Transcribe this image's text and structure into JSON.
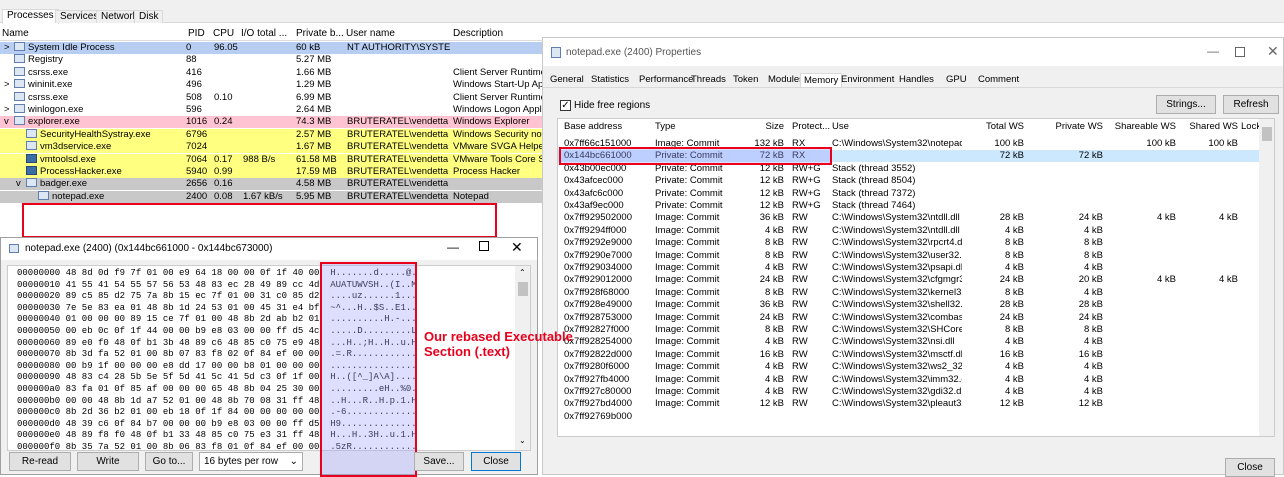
{
  "tabs": [
    "Processes",
    "Services",
    "Network",
    "Disk"
  ],
  "process_columns": [
    "Name",
    "PID",
    "CPU",
    "I/O total ...",
    "Private b...",
    "User name",
    "Description"
  ],
  "processes": [
    {
      "name": "System Idle Process",
      "pid": "0",
      "cpu": "96.05",
      "io": "",
      "priv": "60 kB",
      "user": "NT AUTHORITY\\SYSTEM",
      "desc": "",
      "indent": 0,
      "expander": ">",
      "bg": "#b7cdf2"
    },
    {
      "name": "Registry",
      "pid": "88",
      "cpu": "",
      "io": "",
      "priv": "5.27 MB",
      "user": "",
      "desc": "",
      "indent": 0,
      "expander": "",
      "bg": "#ffffff"
    },
    {
      "name": "csrss.exe",
      "pid": "416",
      "cpu": "",
      "io": "",
      "priv": "1.66 MB",
      "user": "",
      "desc": "Client Server Runtime",
      "indent": 0,
      "expander": "",
      "bg": "#ffffff"
    },
    {
      "name": "wininit.exe",
      "pid": "496",
      "cpu": "",
      "io": "",
      "priv": "1.29 MB",
      "user": "",
      "desc": "Windows Start-Up Ap",
      "indent": 0,
      "expander": ">",
      "bg": "#ffffff"
    },
    {
      "name": "csrss.exe",
      "pid": "508",
      "cpu": "0.10",
      "io": "",
      "priv": "6.99 MB",
      "user": "",
      "desc": "Client Server Runtime",
      "indent": 0,
      "expander": "",
      "bg": "#ffffff"
    },
    {
      "name": "winlogon.exe",
      "pid": "596",
      "cpu": "",
      "io": "",
      "priv": "2.64 MB",
      "user": "",
      "desc": "Windows Logon Appl",
      "indent": 0,
      "expander": ">",
      "bg": "#ffffff"
    },
    {
      "name": "explorer.exe",
      "pid": "1016",
      "cpu": "0.24",
      "io": "",
      "priv": "74.3 MB",
      "user": "BRUTERATEL\\vendetta",
      "desc": "Windows Explorer",
      "indent": 0,
      "expander": "v",
      "bg": "#ffc3d2"
    },
    {
      "name": "SecurityHealthSystray.exe",
      "pid": "6796",
      "cpu": "",
      "io": "",
      "priv": "2.57 MB",
      "user": "BRUTERATEL\\vendetta",
      "desc": "Windows Security not",
      "indent": 1,
      "expander": "",
      "bg": "#ffff80"
    },
    {
      "name": "vm3dservice.exe",
      "pid": "7024",
      "cpu": "",
      "io": "",
      "priv": "1.67 MB",
      "user": "BRUTERATEL\\vendetta",
      "desc": "VMware SVGA Helper",
      "indent": 1,
      "expander": "",
      "bg": "#ffff80"
    },
    {
      "name": "vmtoolsd.exe",
      "pid": "7064",
      "cpu": "0.17",
      "io": "988 B/s",
      "priv": "61.58 MB",
      "user": "BRUTERATEL\\vendetta",
      "desc": "VMware Tools Core Se",
      "indent": 1,
      "expander": "",
      "bg": "#ffff80"
    },
    {
      "name": "ProcessHacker.exe",
      "pid": "5940",
      "cpu": "0.99",
      "io": "",
      "priv": "17.59 MB",
      "user": "BRUTERATEL\\vendetta",
      "desc": "Process Hacker",
      "indent": 1,
      "expander": "",
      "bg": "#ffff80"
    },
    {
      "name": "badger.exe",
      "pid": "2656",
      "cpu": "0.16",
      "io": "",
      "priv": "4.58 MB",
      "user": "BRUTERATEL\\vendetta",
      "desc": "",
      "indent": 1,
      "expander": "v",
      "bg": "#c8c8c8"
    },
    {
      "name": "notepad.exe",
      "pid": "2400",
      "cpu": "0.08",
      "io": "1.67 kB/s",
      "priv": "5.95 MB",
      "user": "BRUTERATEL\\vendetta",
      "desc": "Notepad",
      "indent": 2,
      "expander": "",
      "bg": "#c8c8c8"
    }
  ],
  "hex_window": {
    "title": "notepad.exe (2400) (0x144bc661000 - 0x144bc673000)",
    "lines": [
      {
        "addr": "00000000",
        "hex": "48 8d 0d f9 7f 01 00 e9 64 18 00 00 0f 1f 40 00",
        "ascii": "H.......d.....@."
      },
      {
        "addr": "00000010",
        "hex": "41 55 41 54 55 57 56 53 48 83 ec 28 49 89 cc 4d",
        "ascii": "AUATUWVSH..(I..M"
      },
      {
        "addr": "00000020",
        "hex": "89 c5 85 d2 75 7a 8b 15 ec 7f 01 00 31 c0 85 d2",
        "ascii": "....uz......1..."
      },
      {
        "addr": "00000030",
        "hex": "7e 5e 83 ea 01 48 8b 1d 24 53 01 00 45 31 e4 bf",
        "ascii": "~^...H..$S..E1.."
      },
      {
        "addr": "00000040",
        "hex": "01 00 00 00 89 15 ce 7f 01 00 48 8b 2d ab b2 01",
        "ascii": "..........H.-..."
      },
      {
        "addr": "00000050",
        "hex": "00 eb 0c 0f 1f 44 00 00 b9 e8 03 00 00 ff d5 4c",
        "ascii": ".....D.........L"
      },
      {
        "addr": "00000060",
        "hex": "89 e0 f0 48 0f b1 3b 48 89 c6 48 85 c0 75 e9 48",
        "ascii": "...H..;H..H..u.H"
      },
      {
        "addr": "00000070",
        "hex": "8b 3d fa 52 01 00 8b 07 83 f8 02 0f 84 ef 00 00",
        "ascii": ".=.R............"
      },
      {
        "addr": "00000080",
        "hex": "00 b9 1f 00 00 00 e8 dd 17 00 00 b8 01 00 00 00",
        "ascii": "................"
      },
      {
        "addr": "00000090",
        "hex": "48 83 c4 28 5b 5e 5f 5d 41 5c 41 5d c3 0f 1f 00",
        "ascii": "H..([^_]A\\A]...."
      },
      {
        "addr": "000000a0",
        "hex": "83 fa 01 0f 85 af 00 00 00 65 48 8b 04 25 30 00",
        "ascii": ".........eH..%0."
      },
      {
        "addr": "000000b0",
        "hex": "00 00 48 8b 1d a7 52 01 00 48 8b 70 08 31 ff 48",
        "ascii": "..H...R..H.p.1.H"
      },
      {
        "addr": "000000c0",
        "hex": "8b 2d 36 b2 01 00 eb 18 0f 1f 84 00 00 00 00 00",
        "ascii": ".-6............."
      },
      {
        "addr": "000000d0",
        "hex": "48 39 c6 0f 84 b7 00 00 00 b9 e8 03 00 00 ff d5",
        "ascii": "H9.............."
      },
      {
        "addr": "000000e0",
        "hex": "48 89 f8 f0 48 0f b1 33 48 85 c0 75 e3 31 ff 48",
        "ascii": "H...H..3H..u.1.H"
      },
      {
        "addr": "000000f0",
        "hex": "8b 35 7a 52 01 00 8b 06 83 f8 01 0f 84 ef 00 00",
        "ascii": ".5zR............"
      }
    ],
    "buttons": {
      "reread": "Re-read",
      "write": "Write",
      "goto": "Go to...",
      "bytes_per_row": "16 bytes per row",
      "save": "Save...",
      "close": "Close"
    }
  },
  "annotation": {
    "line1": "Our rebased Executable",
    "line2": "Section (.text)",
    "color": "#e8001c"
  },
  "properties": {
    "title": "notepad.exe (2400) Properties",
    "tabs": [
      "General",
      "Statistics",
      "Performance",
      "Threads",
      "Token",
      "Modules",
      "Memory",
      "Environment",
      "Handles",
      "GPU",
      "Comment"
    ],
    "active_tab": "Memory",
    "hide_free_label": "Hide free regions",
    "strings_btn": "Strings...",
    "refresh_btn": "Refresh",
    "close_btn": "Close",
    "columns": [
      "Base address",
      "Type",
      "Size",
      "Protect...",
      "Use",
      "Total WS",
      "Private WS",
      "Shareable WS",
      "Shared WS",
      "Locke"
    ],
    "rows": [
      [
        "0x7ff66c151000",
        "Image: Commit",
        "132 kB",
        "RX",
        "C:\\Windows\\System32\\notepad.exe",
        "100 kB",
        "",
        "100 kB",
        "100 kB"
      ],
      [
        "0x144bc661000",
        "Private: Commit",
        "72 kB",
        "RX",
        "",
        "72 kB",
        "72 kB",
        "",
        ""
      ],
      [
        "0x43b00ec000",
        "Private: Commit",
        "12 kB",
        "RW+G",
        "Stack (thread 3552)",
        "",
        "",
        "",
        ""
      ],
      [
        "0x43afcec000",
        "Private: Commit",
        "12 kB",
        "RW+G",
        "Stack (thread 8504)",
        "",
        "",
        "",
        ""
      ],
      [
        "0x43afc6c000",
        "Private: Commit",
        "12 kB",
        "RW+G",
        "Stack (thread 7372)",
        "",
        "",
        "",
        ""
      ],
      [
        "0x43af9ec000",
        "Private: Commit",
        "12 kB",
        "RW+G",
        "Stack (thread 7464)",
        "",
        "",
        "",
        ""
      ],
      [
        "0x7ff929502000",
        "Image: Commit",
        "36 kB",
        "RW",
        "C:\\Windows\\System32\\ntdll.dll",
        "28 kB",
        "24 kB",
        "4 kB",
        "4 kB"
      ],
      [
        "0x7ff9294ff000",
        "Image: Commit",
        "4 kB",
        "RW",
        "C:\\Windows\\System32\\ntdll.dll",
        "4 kB",
        "4 kB",
        "",
        ""
      ],
      [
        "0x7ff9292e9000",
        "Image: Commit",
        "8 kB",
        "RW",
        "C:\\Windows\\System32\\rpcrt4.dll",
        "8 kB",
        "8 kB",
        "",
        ""
      ],
      [
        "0x7ff9290e7000",
        "Image: Commit",
        "8 kB",
        "RW",
        "C:\\Windows\\System32\\user32.dll",
        "8 kB",
        "8 kB",
        "",
        ""
      ],
      [
        "0x7ff929034000",
        "Image: Commit",
        "4 kB",
        "RW",
        "C:\\Windows\\System32\\psapi.dll",
        "4 kB",
        "4 kB",
        "",
        ""
      ],
      [
        "0x7ff929012000",
        "Image: Commit",
        "24 kB",
        "RW",
        "C:\\Windows\\System32\\cfgmgr32.dll",
        "24 kB",
        "20 kB",
        "4 kB",
        "4 kB"
      ],
      [
        "0x7ff928f68000",
        "Image: Commit",
        "8 kB",
        "RW",
        "C:\\Windows\\System32\\kernel32.dll",
        "8 kB",
        "4 kB",
        "",
        ""
      ],
      [
        "0x7ff928e49000",
        "Image: Commit",
        "36 kB",
        "RW",
        "C:\\Windows\\System32\\shell32.dll",
        "28 kB",
        "28 kB",
        "",
        ""
      ],
      [
        "0x7ff928753000",
        "Image: Commit",
        "24 kB",
        "RW",
        "C:\\Windows\\System32\\combase.dll",
        "24 kB",
        "24 kB",
        "",
        ""
      ],
      [
        "0x7ff92827f000",
        "Image: Commit",
        "8 kB",
        "RW",
        "C:\\Windows\\System32\\SHCore.dll",
        "8 kB",
        "8 kB",
        "",
        ""
      ],
      [
        "0x7ff928254000",
        "Image: Commit",
        "4 kB",
        "RW",
        "C:\\Windows\\System32\\nsi.dll",
        "4 kB",
        "4 kB",
        "",
        ""
      ],
      [
        "0x7ff92822d000",
        "Image: Commit",
        "16 kB",
        "RW",
        "C:\\Windows\\System32\\msctf.dll",
        "16 kB",
        "16 kB",
        "",
        ""
      ],
      [
        "0x7ff9280f6000",
        "Image: Commit",
        "4 kB",
        "RW",
        "C:\\Windows\\System32\\ws2_32.dll",
        "4 kB",
        "4 kB",
        "",
        ""
      ],
      [
        "0x7ff927fb4000",
        "Image: Commit",
        "4 kB",
        "RW",
        "C:\\Windows\\System32\\imm32.dll",
        "4 kB",
        "4 kB",
        "",
        ""
      ],
      [
        "0x7ff927c80000",
        "Image: Commit",
        "4 kB",
        "RW",
        "C:\\Windows\\System32\\gdi32.dll",
        "4 kB",
        "4 kB",
        "",
        ""
      ],
      [
        "0x7ff927bd4000",
        "Image: Commit",
        "12 kB",
        "RW",
        "C:\\Windows\\System32\\pleaut32.dll",
        "12 kB",
        "12 kB",
        "",
        ""
      ],
      [
        "0x7ff92769b000",
        "",
        "",
        "",
        "",
        "",
        "",
        "",
        ""
      ]
    ]
  },
  "colors": {
    "highlight_red": "#e8001c",
    "selected_row": "#cce8ff",
    "hex_select": "#c9c9ff"
  }
}
